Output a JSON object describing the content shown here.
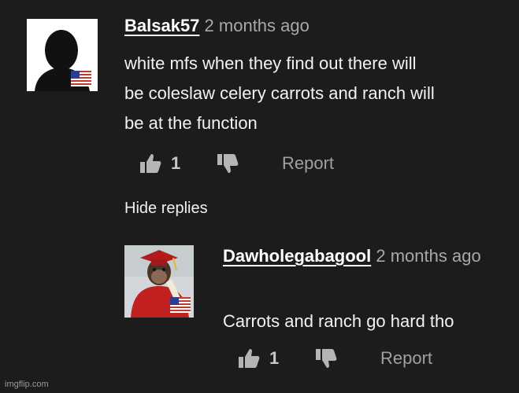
{
  "comment": {
    "username": "Balsak57",
    "time_ago": "2 months ago",
    "text_lines": [
      "white mfs when they find out there will",
      "be coleslaw celery carrots and ranch will",
      "be at the function"
    ],
    "like_count": "1",
    "report_label": "Report"
  },
  "hide_replies_label": "Hide replies",
  "reply": {
    "username": "Dawholegabagool",
    "time_ago": "2 months ago",
    "text": "Carrots and ranch go hard tho",
    "like_count": "1",
    "report_label": "Report"
  },
  "watermark": "imgflip.com",
  "icons": {
    "like": "thumbs-up-icon",
    "dislike": "thumbs-down-icon",
    "flag": "us-flag-icon"
  },
  "colors": {
    "background": "#1c1c1c",
    "text": "#f2f2f2",
    "muted": "#a8a8a8"
  }
}
